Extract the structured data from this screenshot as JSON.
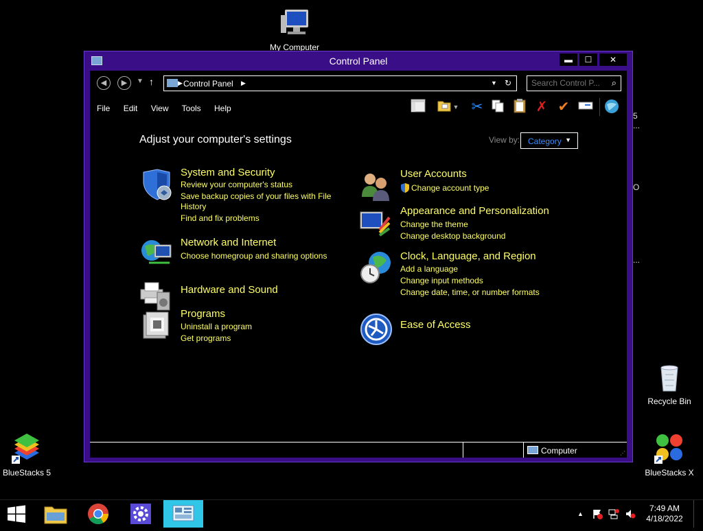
{
  "desktop": {
    "icons": {
      "my_computer": "My Computer",
      "recycle_bin": "Recycle Bin",
      "bluestacks5": "BlueStacks 5",
      "bluestacksx": "BlueStacks X"
    },
    "stray_text": [
      "5",
      "...",
      "O",
      "..."
    ]
  },
  "window": {
    "title": "Control Panel",
    "buttons": {
      "minimize": "▬",
      "maximize": "☐",
      "close": "✕"
    },
    "address": {
      "path_item": "Control Panel"
    },
    "search": {
      "placeholder": "Search Control P..."
    },
    "menu": [
      "File",
      "Edit",
      "View",
      "Tools",
      "Help"
    ],
    "heading": "Adjust your computer's settings",
    "view_by": {
      "label": "View by:",
      "value": "Category"
    },
    "categories_left": [
      {
        "title": "System and Security",
        "links": [
          "Review your computer's status",
          "Save backup copies of your files with File",
          "History",
          "Find and fix problems"
        ]
      },
      {
        "title": "Network and Internet",
        "links": [
          "Choose homegroup and sharing options"
        ]
      },
      {
        "title": "Hardware and Sound",
        "links": []
      },
      {
        "title": "Programs",
        "links": [
          "Uninstall a program",
          "Get programs"
        ]
      }
    ],
    "categories_right": [
      {
        "title": "User Accounts",
        "links": [
          "Change account type"
        ]
      },
      {
        "title": "Appearance and Personalization",
        "links": [
          "Change the theme",
          "Change desktop background"
        ]
      },
      {
        "title": "Clock, Language, and Region",
        "links": [
          "Add a language",
          "Change input methods",
          "Change date, time, or number formats"
        ]
      },
      {
        "title": "Ease of Access",
        "links": []
      }
    ],
    "statusbar": {
      "location": "Computer"
    }
  },
  "taskbar": {
    "clock_time": "7:49 AM",
    "clock_date": "4/18/2022"
  },
  "colors": {
    "window_frame": "#3a0e86",
    "link": "#ffff66",
    "taskbar_active": "#2fc6e8",
    "view_select": "#3c8dff"
  }
}
